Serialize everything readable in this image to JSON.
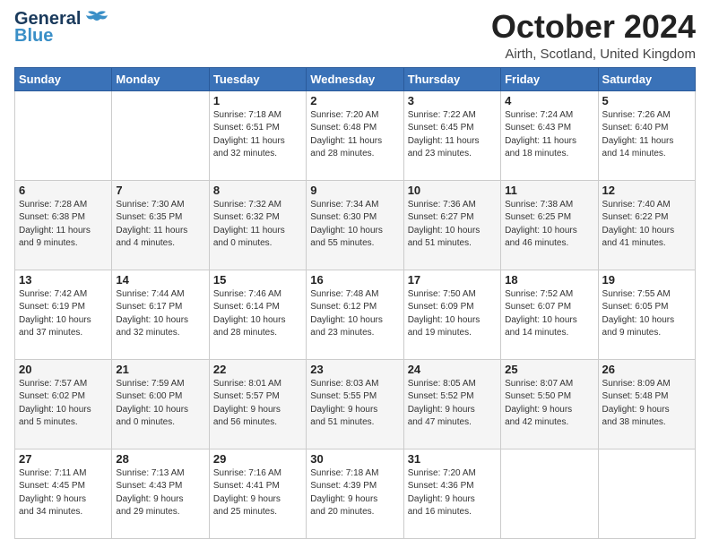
{
  "header": {
    "logo_line1": "General",
    "logo_line2": "Blue",
    "month_title": "October 2024",
    "location": "Airth, Scotland, United Kingdom"
  },
  "weekdays": [
    "Sunday",
    "Monday",
    "Tuesday",
    "Wednesday",
    "Thursday",
    "Friday",
    "Saturday"
  ],
  "weeks": [
    [
      {
        "day": "",
        "info": ""
      },
      {
        "day": "",
        "info": ""
      },
      {
        "day": "1",
        "info": "Sunrise: 7:18 AM\nSunset: 6:51 PM\nDaylight: 11 hours\nand 32 minutes."
      },
      {
        "day": "2",
        "info": "Sunrise: 7:20 AM\nSunset: 6:48 PM\nDaylight: 11 hours\nand 28 minutes."
      },
      {
        "day": "3",
        "info": "Sunrise: 7:22 AM\nSunset: 6:45 PM\nDaylight: 11 hours\nand 23 minutes."
      },
      {
        "day": "4",
        "info": "Sunrise: 7:24 AM\nSunset: 6:43 PM\nDaylight: 11 hours\nand 18 minutes."
      },
      {
        "day": "5",
        "info": "Sunrise: 7:26 AM\nSunset: 6:40 PM\nDaylight: 11 hours\nand 14 minutes."
      }
    ],
    [
      {
        "day": "6",
        "info": "Sunrise: 7:28 AM\nSunset: 6:38 PM\nDaylight: 11 hours\nand 9 minutes."
      },
      {
        "day": "7",
        "info": "Sunrise: 7:30 AM\nSunset: 6:35 PM\nDaylight: 11 hours\nand 4 minutes."
      },
      {
        "day": "8",
        "info": "Sunrise: 7:32 AM\nSunset: 6:32 PM\nDaylight: 11 hours\nand 0 minutes."
      },
      {
        "day": "9",
        "info": "Sunrise: 7:34 AM\nSunset: 6:30 PM\nDaylight: 10 hours\nand 55 minutes."
      },
      {
        "day": "10",
        "info": "Sunrise: 7:36 AM\nSunset: 6:27 PM\nDaylight: 10 hours\nand 51 minutes."
      },
      {
        "day": "11",
        "info": "Sunrise: 7:38 AM\nSunset: 6:25 PM\nDaylight: 10 hours\nand 46 minutes."
      },
      {
        "day": "12",
        "info": "Sunrise: 7:40 AM\nSunset: 6:22 PM\nDaylight: 10 hours\nand 41 minutes."
      }
    ],
    [
      {
        "day": "13",
        "info": "Sunrise: 7:42 AM\nSunset: 6:19 PM\nDaylight: 10 hours\nand 37 minutes."
      },
      {
        "day": "14",
        "info": "Sunrise: 7:44 AM\nSunset: 6:17 PM\nDaylight: 10 hours\nand 32 minutes."
      },
      {
        "day": "15",
        "info": "Sunrise: 7:46 AM\nSunset: 6:14 PM\nDaylight: 10 hours\nand 28 minutes."
      },
      {
        "day": "16",
        "info": "Sunrise: 7:48 AM\nSunset: 6:12 PM\nDaylight: 10 hours\nand 23 minutes."
      },
      {
        "day": "17",
        "info": "Sunrise: 7:50 AM\nSunset: 6:09 PM\nDaylight: 10 hours\nand 19 minutes."
      },
      {
        "day": "18",
        "info": "Sunrise: 7:52 AM\nSunset: 6:07 PM\nDaylight: 10 hours\nand 14 minutes."
      },
      {
        "day": "19",
        "info": "Sunrise: 7:55 AM\nSunset: 6:05 PM\nDaylight: 10 hours\nand 9 minutes."
      }
    ],
    [
      {
        "day": "20",
        "info": "Sunrise: 7:57 AM\nSunset: 6:02 PM\nDaylight: 10 hours\nand 5 minutes."
      },
      {
        "day": "21",
        "info": "Sunrise: 7:59 AM\nSunset: 6:00 PM\nDaylight: 10 hours\nand 0 minutes."
      },
      {
        "day": "22",
        "info": "Sunrise: 8:01 AM\nSunset: 5:57 PM\nDaylight: 9 hours\nand 56 minutes."
      },
      {
        "day": "23",
        "info": "Sunrise: 8:03 AM\nSunset: 5:55 PM\nDaylight: 9 hours\nand 51 minutes."
      },
      {
        "day": "24",
        "info": "Sunrise: 8:05 AM\nSunset: 5:52 PM\nDaylight: 9 hours\nand 47 minutes."
      },
      {
        "day": "25",
        "info": "Sunrise: 8:07 AM\nSunset: 5:50 PM\nDaylight: 9 hours\nand 42 minutes."
      },
      {
        "day": "26",
        "info": "Sunrise: 8:09 AM\nSunset: 5:48 PM\nDaylight: 9 hours\nand 38 minutes."
      }
    ],
    [
      {
        "day": "27",
        "info": "Sunrise: 7:11 AM\nSunset: 4:45 PM\nDaylight: 9 hours\nand 34 minutes."
      },
      {
        "day": "28",
        "info": "Sunrise: 7:13 AM\nSunset: 4:43 PM\nDaylight: 9 hours\nand 29 minutes."
      },
      {
        "day": "29",
        "info": "Sunrise: 7:16 AM\nSunset: 4:41 PM\nDaylight: 9 hours\nand 25 minutes."
      },
      {
        "day": "30",
        "info": "Sunrise: 7:18 AM\nSunset: 4:39 PM\nDaylight: 9 hours\nand 20 minutes."
      },
      {
        "day": "31",
        "info": "Sunrise: 7:20 AM\nSunset: 4:36 PM\nDaylight: 9 hours\nand 16 minutes."
      },
      {
        "day": "",
        "info": ""
      },
      {
        "day": "",
        "info": ""
      }
    ]
  ]
}
